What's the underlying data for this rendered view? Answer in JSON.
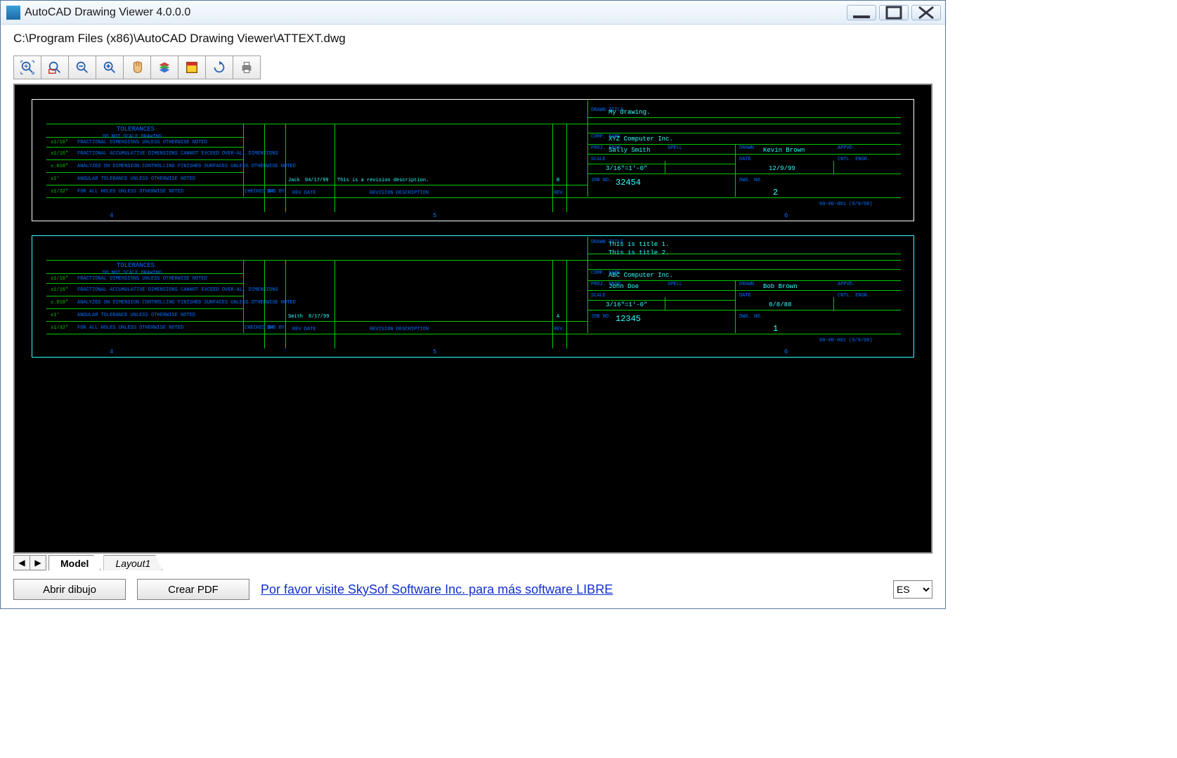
{
  "window": {
    "title": "AutoCAD Drawing Viewer 4.0.0.0"
  },
  "filepath": "C:\\Program Files (x86)\\AutoCAD Drawing Viewer\\ATTEXT.dwg",
  "toolbar": {
    "btn_zoom_extents": "Zoom Extents",
    "btn_zoom_window": "Zoom Window",
    "btn_zoom_out": "Zoom Out",
    "btn_zoom_in": "Zoom In",
    "btn_pan": "Pan",
    "btn_layers": "Layers",
    "btn_window": "Window",
    "btn_refresh": "Refresh",
    "btn_print": "Print"
  },
  "tabs": {
    "prev": "◀",
    "next": "▶",
    "model": "Model",
    "layout1": "Layout1"
  },
  "footer": {
    "open": "Abrir dibujo",
    "pdf": "Crear PDF",
    "link": "Por favor visite SkySof Software Inc. para más software LIBRE",
    "lang": "ES"
  },
  "block1": {
    "tol_title": "TOLERANCES",
    "tol_sub": "DO NOT SCALE DRAWING",
    "tol1_pfx": "±1/16\"",
    "tol1": "FRACTIONAL DIMENSIONS UNLESS OTHERWISE NOTED",
    "tol2_pfx": "±1/16\"",
    "tol2": "FRACTIONAL ACCUMULATIVE DIMENSIONS CANNOT EXCEED OVER-ALL DIMENSIONS",
    "tol3_pfx": "±.010\"",
    "tol3": "ANALYZED ON DIMENSION CONTROLLING FINISHED SURFACES UNLESS OTHERWISE NOTED",
    "tol4_pfx": "±1°",
    "tol4": "ANGULAR TOLERANCE UNLESS OTHERWISE NOTED",
    "tol5_pfx": "±1/32\"",
    "tol5": "FOR ALL HOLES UNLESS OTHERWISE NOTED",
    "checked_by": "CHECKED BY",
    "dwg_by": "DWG BY",
    "rev_date": "REV DATE",
    "rev_desc": "REVISION DESCRIPTION",
    "rev": "REV.",
    "rev_entry_name": "Jack",
    "rev_entry_date": "04/17/99",
    "rev_entry_text": "This is a revision description.",
    "rev_letter": "B",
    "drawn_title_lbl": "DRAWN TITLE",
    "drawn_title": "My drawing.",
    "comp_name_lbl": "COMP. NAME",
    "comp_name": "XYZ Computer Inc.",
    "proj_engr_lbl": "PROJ. ENGR.",
    "proj_engr": "Sally Smith",
    "scale_lbl": "SCALE",
    "scale": "3/16\"=1'-0\"",
    "spell_lbl": "SPELL",
    "drawn_lbl": "DRAWN",
    "drawn": "Kevin Brown",
    "date_lbl": "DATE",
    "date": "12/9/99",
    "appvd_lbl": "APPVD.",
    "cntl_engr_lbl": "CNTL. ENGR.",
    "job_no_lbl": "JOB NO.",
    "job_no": "32454",
    "dwg_no_lbl": "DWG. NO.",
    "dwg_no": "2",
    "footer_code": "00-00-001 (9/9/00)",
    "ruler": {
      "a": "4",
      "b": "5",
      "c": "6"
    }
  },
  "block2": {
    "tol_title": "TOLERANCES",
    "tol_sub": "DO NOT SCALE DRAWING",
    "tol1_pfx": "±1/16\"",
    "tol1": "FRACTIONAL DIMENSIONS UNLESS OTHERWISE NOTED",
    "tol2_pfx": "±1/16\"",
    "tol2": "FRACTIONAL ACCUMULATIVE DIMENSIONS CANNOT EXCEED OVER-ALL DIMENSIONS",
    "tol3_pfx": "±.010\"",
    "tol3": "ANALYZED ON DIMENSION CONTROLLING FINISHED SURFACES UNLESS OTHERWISE NOTED",
    "tol4_pfx": "±1°",
    "tol4": "ANGULAR TOLERANCE UNLESS OTHERWISE NOTED",
    "tol5_pfx": "±1/32\"",
    "tol5": "FOR ALL HOLES UNLESS OTHERWISE NOTED",
    "checked_by": "CHECKED BY",
    "dwg_by": "DWG BY",
    "rev_date": "REV DATE",
    "rev_desc": "REVISION DESCRIPTION",
    "rev": "REV.",
    "rev_entry_name": "Smith",
    "rev_entry_date": "8/17/99",
    "rev_entry_text": "",
    "rev_letter": "A",
    "drawn_title_lbl": "DRAWN TITLE",
    "drawn_title1": "This is title 1.",
    "drawn_title2": "This is title 2.",
    "comp_name_lbl": "COMP. NAME",
    "comp_name": "ABC Computer Inc.",
    "proj_engr_lbl": "PROJ. ENGR.",
    "proj_engr": "John Doe",
    "scale_lbl": "SCALE",
    "scale": "3/16\"=1'-0\"",
    "spell_lbl": "SPELL",
    "drawn_lbl": "DRAWN",
    "drawn": "Bob Brown",
    "date_lbl": "DATE",
    "date": "8/8/88",
    "appvd_lbl": "APPVD.",
    "cntl_engr_lbl": "CNTL. ENGR.",
    "job_no_lbl": "JOB NO.",
    "job_no": "12345",
    "dwg_no_lbl": "DWG. NO.",
    "dwg_no": "1",
    "footer_code": "00-00-001 (9/9/00)",
    "ruler": {
      "a": "4",
      "b": "5",
      "c": "6"
    }
  }
}
